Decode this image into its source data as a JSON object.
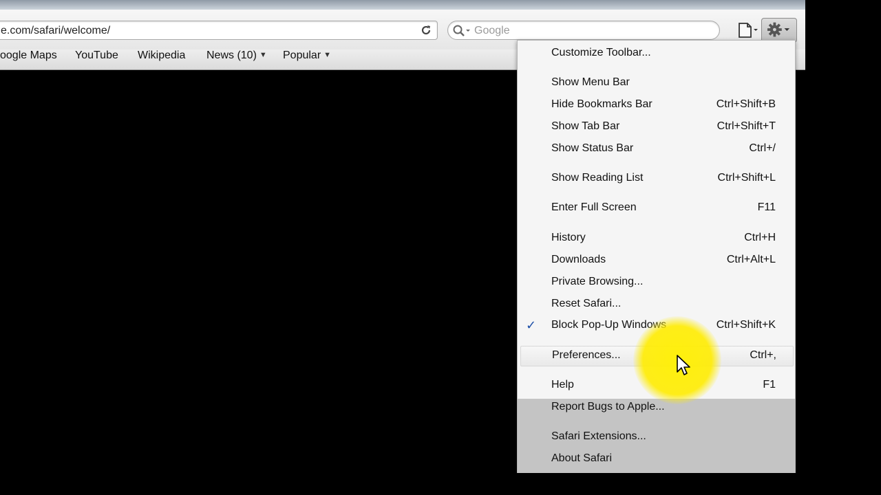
{
  "address_bar": {
    "url": "e.com/safari/welcome/"
  },
  "search_bar": {
    "placeholder": "Google"
  },
  "bookmarks": [
    {
      "label": "oogle Maps"
    },
    {
      "label": "YouTube"
    },
    {
      "label": "Wikipedia"
    },
    {
      "label": "News (10)"
    },
    {
      "label": "Popular"
    }
  ],
  "menu": {
    "items": [
      {
        "label": "Customize Toolbar...",
        "shortcut": ""
      },
      {
        "label": "Show Menu Bar",
        "shortcut": ""
      },
      {
        "label": "Hide Bookmarks Bar",
        "shortcut": "Ctrl+Shift+B"
      },
      {
        "label": "Show Tab Bar",
        "shortcut": "Ctrl+Shift+T"
      },
      {
        "label": "Show Status Bar",
        "shortcut": "Ctrl+/"
      },
      {
        "label": "Show Reading List",
        "shortcut": "Ctrl+Shift+L"
      },
      {
        "label": "Enter Full Screen",
        "shortcut": "F11"
      },
      {
        "label": "History",
        "shortcut": "Ctrl+H"
      },
      {
        "label": "Downloads",
        "shortcut": "Ctrl+Alt+L"
      },
      {
        "label": "Private Browsing...",
        "shortcut": ""
      },
      {
        "label": "Reset Safari...",
        "shortcut": ""
      },
      {
        "label": "Block Pop-Up Windows",
        "shortcut": "Ctrl+Shift+K",
        "checked": true
      },
      {
        "label": "Preferences...",
        "shortcut": "Ctrl+,",
        "highlighted": true
      },
      {
        "label": "Help",
        "shortcut": "F1"
      },
      {
        "label": "Report Bugs to Apple...",
        "shortcut": ""
      },
      {
        "label": "Safari Extensions...",
        "shortcut": ""
      },
      {
        "label": "About Safari",
        "shortcut": ""
      }
    ],
    "check_glyph": "✓"
  },
  "colors": {
    "check": "#1d4fa8",
    "spotlight": "#ffec00",
    "content_bg": "#000000"
  },
  "icons": [
    "reload-icon",
    "search-icon",
    "page-menu-icon",
    "gear-icon",
    "dropdown-triangle-icon",
    "mouse-cursor-icon"
  ]
}
